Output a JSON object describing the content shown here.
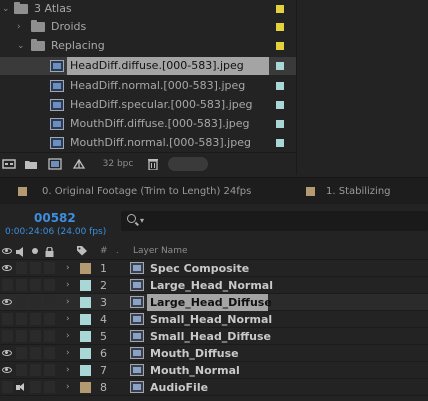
{
  "project": {
    "items": [
      {
        "name": "3 Atlas",
        "type": "folder",
        "label_color": "#e4d23c",
        "expanded": true
      },
      {
        "name": "Droids",
        "type": "folder",
        "label_color": "#e4d23c",
        "expanded": false
      },
      {
        "name": "Replacing",
        "type": "folder",
        "label_color": "#e4d23c",
        "expanded": true
      },
      {
        "name": "HeadDiff.diffuse.[000-583].jpeg",
        "type": "image-sequence",
        "label_color": "#a9d7d6",
        "selected": true
      },
      {
        "name": "HeadDiff.normal.[000-583].jpeg",
        "type": "image-sequence",
        "label_color": "#a9d7d6"
      },
      {
        "name": "HeadDiff.specular.[000-583].jpeg",
        "type": "image-sequence",
        "label_color": "#a9d7d6"
      },
      {
        "name": "MouthDiff.diffuse.[000-583].jpeg",
        "type": "image-sequence",
        "label_color": "#a9d7d6"
      },
      {
        "name": "MouthDiff.normal.[000-583].jpeg",
        "type": "image-sequence",
        "label_color": "#a9d7d6"
      }
    ],
    "toolbar": {
      "bpc_label": "32 bpc",
      "icons": [
        "interpret-footage-icon",
        "new-folder-icon",
        "new-composition-icon",
        "project-settings-icon",
        "flowchart-icon",
        "trash-icon"
      ]
    }
  },
  "tabs": [
    {
      "label": "0. Original Footage (Trim to Length) 24fps",
      "color": "#b49a73"
    },
    {
      "label": "1. Stabilizing",
      "color": "#b49a73"
    }
  ],
  "timeline": {
    "timecode": "00582",
    "frame_info": "0:00:24:06 (24.00 fps)",
    "search_placeholder": ""
  },
  "columns": {
    "number": "#",
    "layer_name": "Layer Name"
  },
  "layers": [
    {
      "num": "1",
      "name": "Spec Composite",
      "label_color": "#b49a73",
      "visible": true,
      "audio": false,
      "kind": "comp"
    },
    {
      "num": "2",
      "name": "Large_Head_Normal",
      "label_color": "#a9d7d6",
      "visible": false,
      "audio": false,
      "kind": "footage"
    },
    {
      "num": "3",
      "name": "Large_Head_Diffuse",
      "label_color": "#a9d7d6",
      "visible": true,
      "audio": false,
      "kind": "footage",
      "selected": true
    },
    {
      "num": "4",
      "name": "Small_Head_Normal",
      "label_color": "#a9d7d6",
      "visible": false,
      "audio": false,
      "kind": "footage"
    },
    {
      "num": "5",
      "name": "Small_Head_Diffuse",
      "label_color": "#a9d7d6",
      "visible": false,
      "audio": false,
      "kind": "footage"
    },
    {
      "num": "6",
      "name": "Mouth_Diffuse",
      "label_color": "#a9d7d6",
      "visible": true,
      "audio": false,
      "kind": "footage"
    },
    {
      "num": "7",
      "name": "Mouth_Normal",
      "label_color": "#a9d7d6",
      "visible": true,
      "audio": false,
      "kind": "footage"
    },
    {
      "num": "8",
      "name": "AudioFile",
      "label_color": "#b49a73",
      "visible": false,
      "audio": true,
      "kind": "audio"
    }
  ]
}
